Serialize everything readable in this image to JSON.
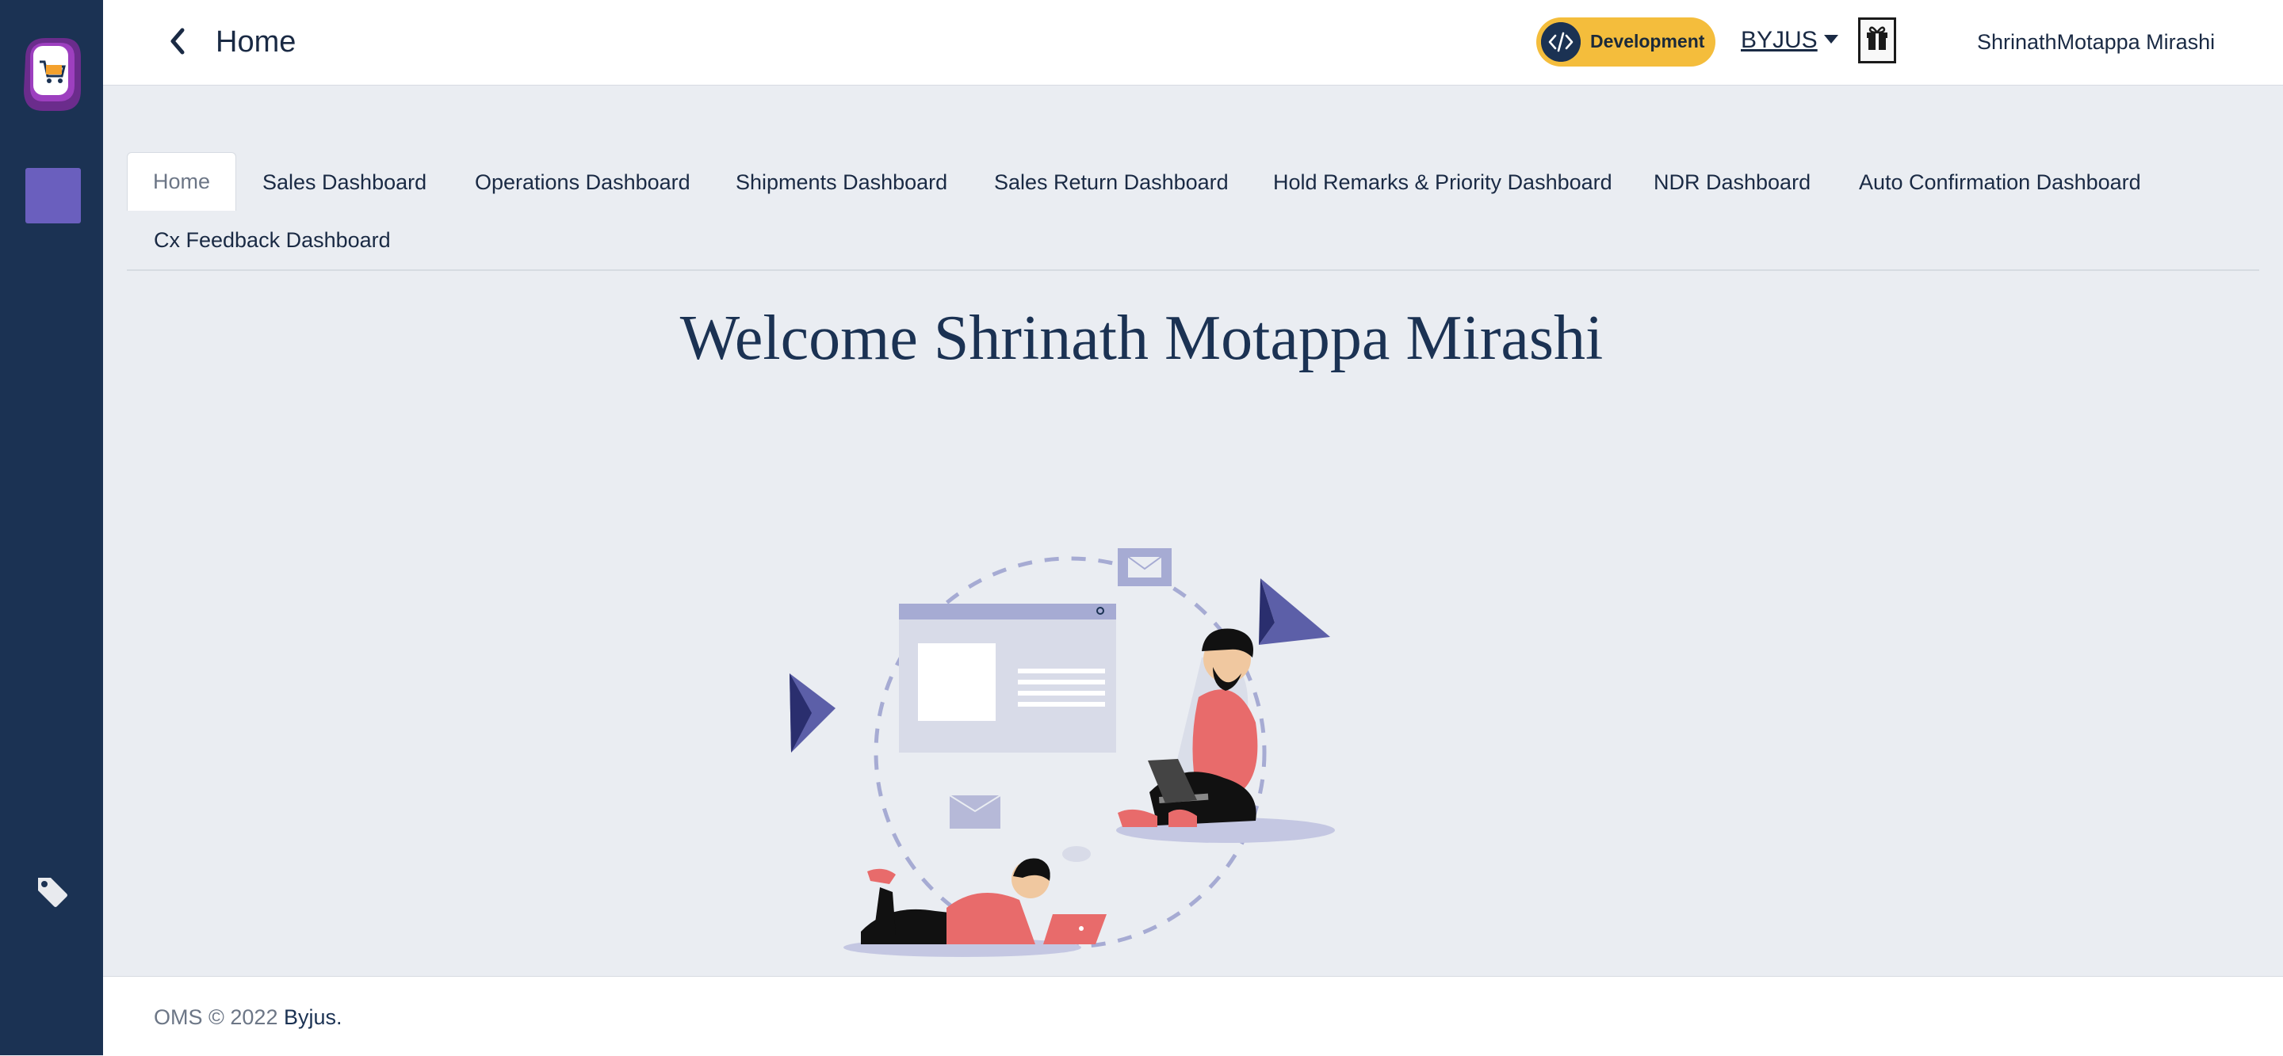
{
  "header": {
    "title": "Home",
    "environment_badge": "Development",
    "org_selector": "BYJUS",
    "user_name": "ShrinathMotappa Mirashi"
  },
  "tabs": [
    {
      "label": "Home",
      "active": true
    },
    {
      "label": "Sales Dashboard",
      "active": false
    },
    {
      "label": "Operations Dashboard",
      "active": false
    },
    {
      "label": "Shipments Dashboard",
      "active": false
    },
    {
      "label": "Sales Return Dashboard",
      "active": false
    },
    {
      "label": "Hold Remarks & Priority Dashboard",
      "active": false
    },
    {
      "label": "NDR Dashboard",
      "active": false
    },
    {
      "label": "Auto Confirmation Dashboard",
      "active": false
    },
    {
      "label": "Cx Feedback Dashboard",
      "active": false
    }
  ],
  "main": {
    "welcome": "Welcome Shrinath Motappa Mirashi"
  },
  "footer": {
    "copyright": "OMS © 2022 ",
    "brand": "Byjus."
  },
  "icons": {
    "logo": "shopping-cart-logo-icon",
    "sidebar_square": "app-icon",
    "sidebar_tag": "tag-icon",
    "back": "chevron-left-icon",
    "env": "code-icon",
    "gift": "gift-icon"
  },
  "colors": {
    "sidebar": "#1b3253",
    "accent_purple": "#6a5fbe",
    "badge_yellow": "#f4bd3c",
    "background": "#eaedf2",
    "illustration_red": "#e86b6b"
  }
}
